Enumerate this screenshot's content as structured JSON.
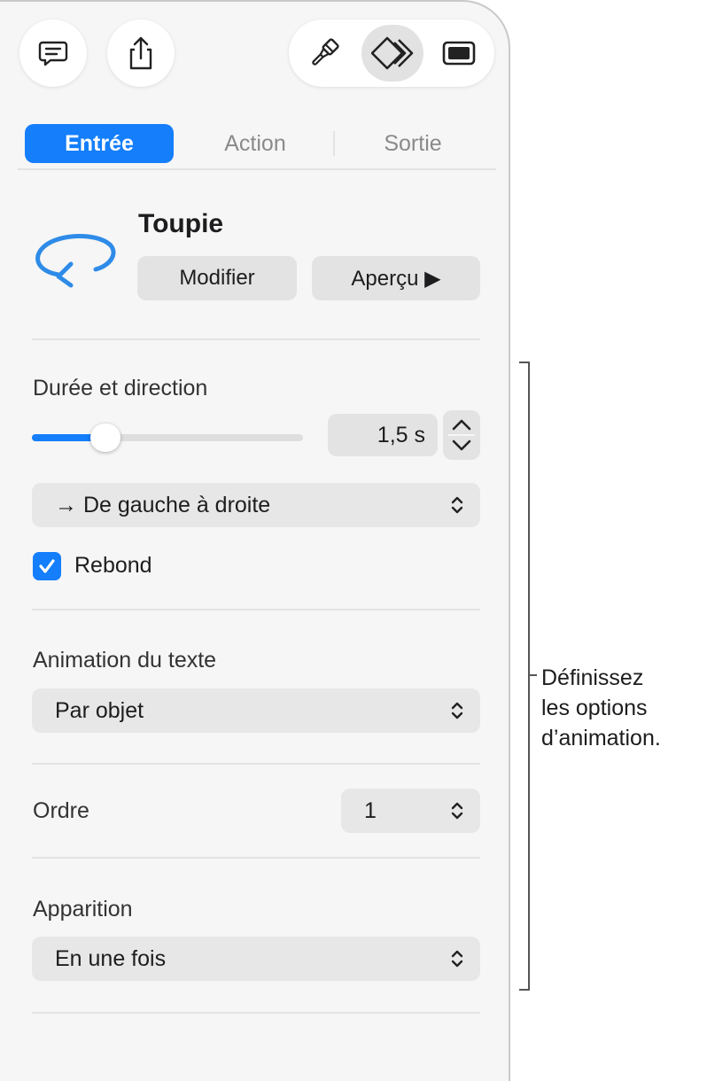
{
  "toolbar": {
    "left_icons": [
      "comment-icon",
      "share-icon"
    ],
    "segment_icons": [
      "format-brush-icon",
      "animate-icon",
      "document-icon"
    ],
    "active_segment": "animate-icon"
  },
  "tabs": [
    {
      "label": "Entrée",
      "active": true
    },
    {
      "label": "Action",
      "active": false
    },
    {
      "label": "Sortie",
      "active": false
    }
  ],
  "effect": {
    "name": "Toupie",
    "icon": "spin-arrow-icon",
    "modify_label": "Modifier",
    "preview_label": "Aperçu ▶"
  },
  "duration": {
    "label": "Durée et direction",
    "slider_fraction": 0.27,
    "value": "1,5 s",
    "direction": "→ De gauche à droite",
    "bounce_label": "Rebond",
    "bounce_checked": true
  },
  "text_animation": {
    "label": "Animation du texte",
    "value": "Par objet"
  },
  "order": {
    "label": "Ordre",
    "value": "1"
  },
  "appearance": {
    "label": "Apparition",
    "value": "En une fois"
  },
  "callout": {
    "lines": [
      "Définissez",
      "les options",
      "d’animation."
    ]
  },
  "colors": {
    "accent": "#147efb",
    "panel": "#f6f6f6",
    "control": "#e3e3e3"
  }
}
